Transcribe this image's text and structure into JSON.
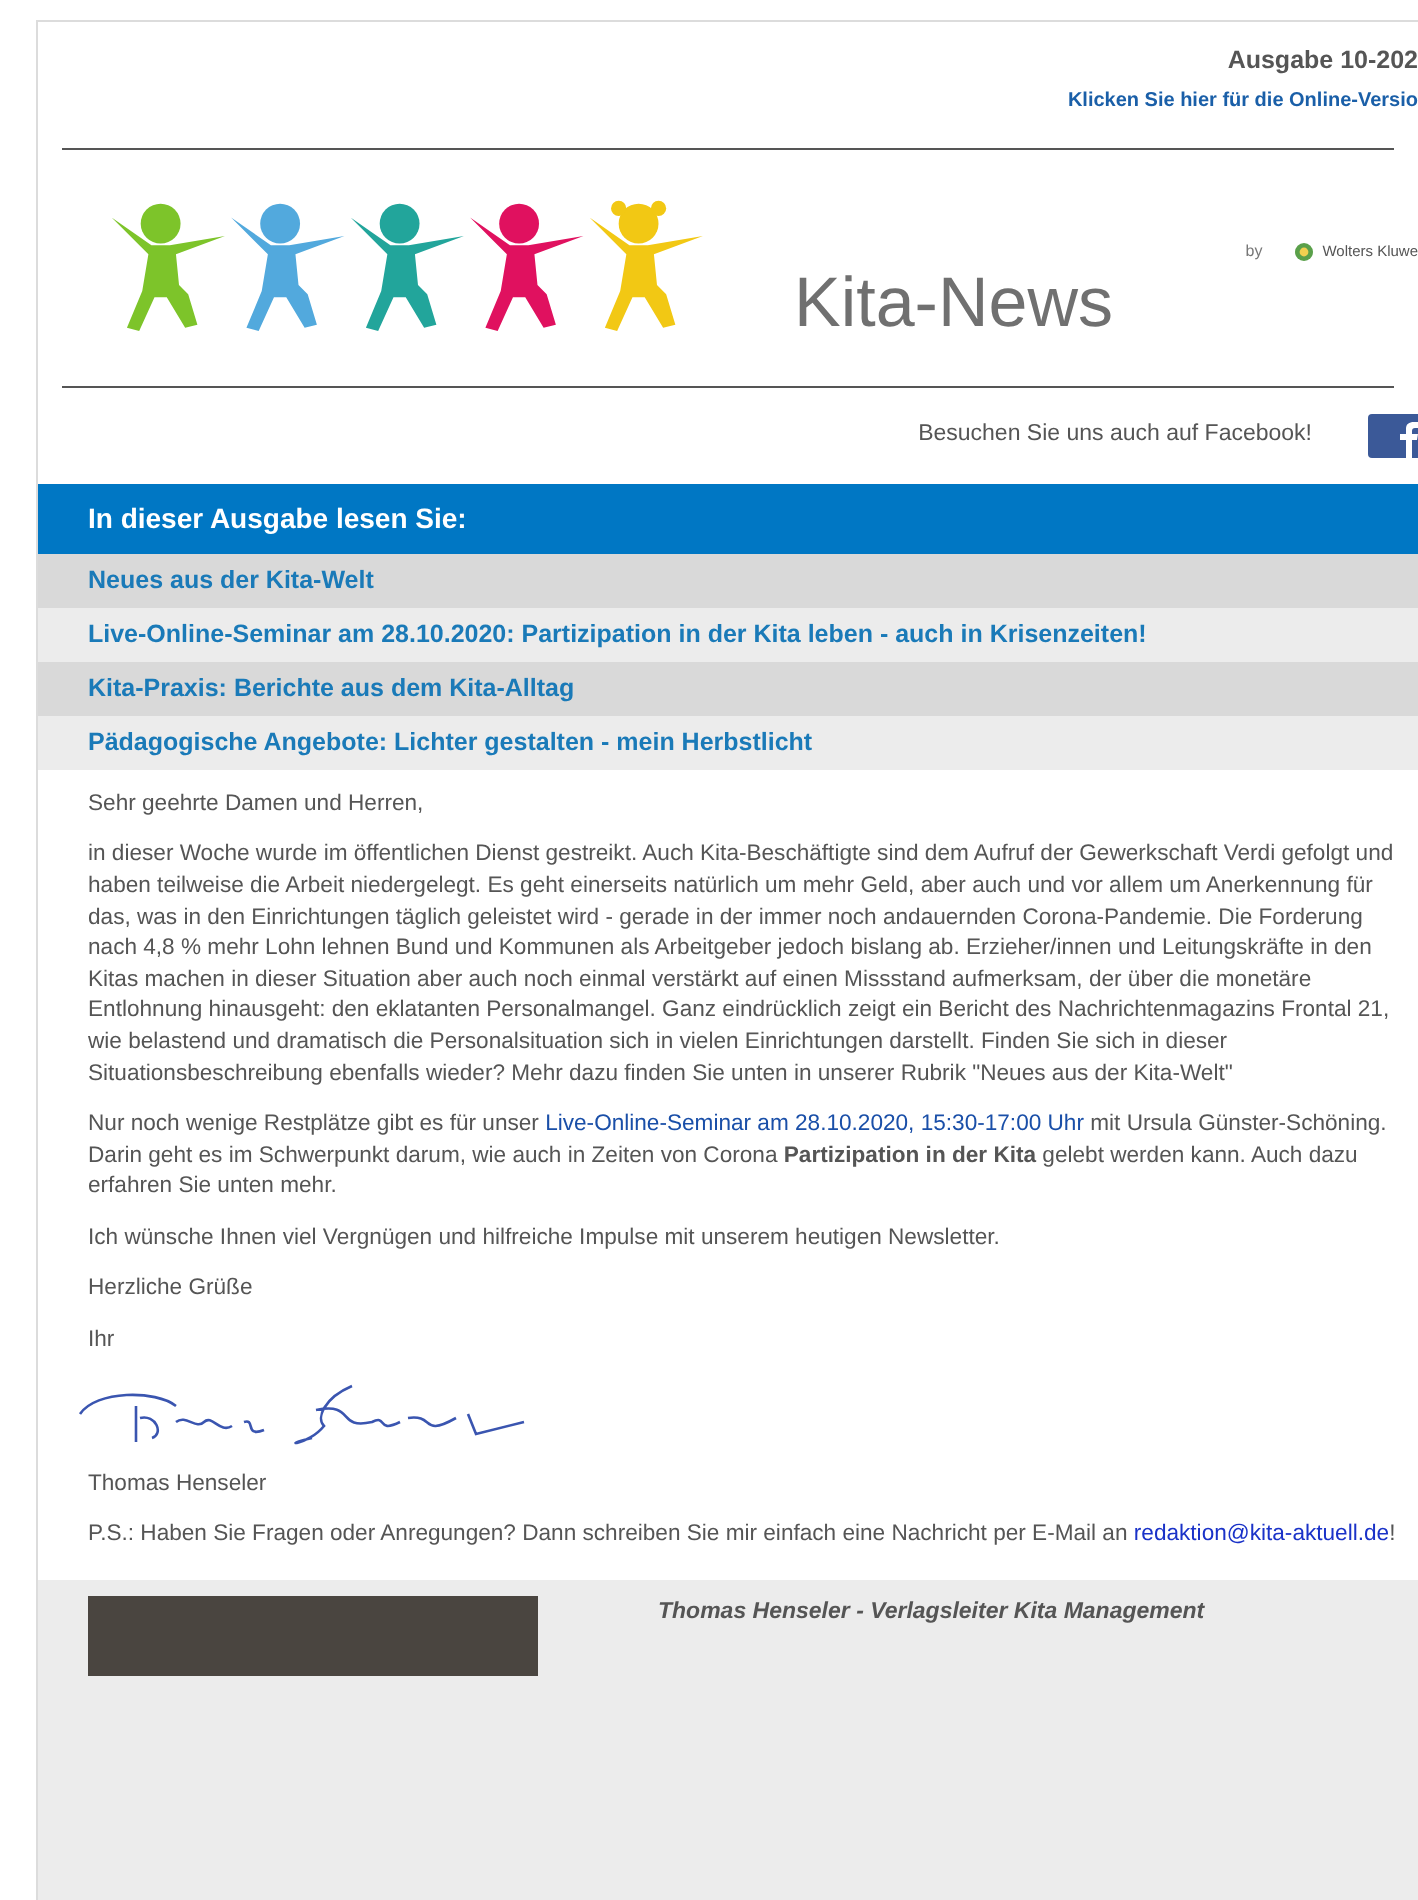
{
  "header": {
    "issue": "Ausgabe 10-202",
    "online_link": "Klicken Sie hier für die Online-Versio"
  },
  "logo": {
    "title": "Kita-News",
    "by": "by",
    "publisher": "Wolters Kluwe"
  },
  "social": {
    "text": "Besuchen Sie uns auch auf Facebook!"
  },
  "toc": {
    "title": "In dieser Ausgabe lesen Sie:",
    "items": [
      {
        "label": "Neues aus der Kita-Welt"
      },
      {
        "label": "Live-Online-Seminar am 28.10.2020: Partizipation in der Kita leben - auch in Krisenzeiten!"
      },
      {
        "label": "Kita-Praxis: Berichte aus dem Kita-Alltag"
      },
      {
        "label": "Pädagogische Angebote: Lichter gestalten - mein Herbstlicht"
      }
    ]
  },
  "letter": {
    "greeting": "Sehr geehrte Damen und Herren,",
    "paragraph_1": "in dieser Woche wurde im öffentlichen Dienst gestreikt. Auch Kita-Beschäftigte sind dem Aufruf der Gewerkschaft Verdi gefolgt und haben teilweise die Arbeit niedergelegt. Es geht einerseits natürlich um mehr Geld, aber auch und vor allem um Anerkennung für das, was in den Einrichtungen täglich geleistet wird - gerade in der immer noch andauernden Corona-Pandemie. Die Forderung nach 4,8 % mehr Lohn lehnen Bund und Kommunen als Arbeitgeber jedoch bislang ab. Erzieher/innen und Leitungskräfte in den Kitas machen in dieser Situation aber auch noch einmal verstärkt auf einen Missstand aufmerksam, der über die monetäre Entlohnung hinausgeht: den eklatanten Personalmangel. Ganz eindrücklich zeigt ein Bericht des Nachrichtenmagazins Frontal 21, wie belastend und dramatisch die Personalsituation sich in vielen Einrichtungen darstellt. Finden Sie sich in dieser Situationsbeschreibung ebenfalls wieder? Mehr dazu finden Sie unten in unserer Rubrik \"Neues aus der Kita-Welt\"",
    "paragraph_2": {
      "before": "Nur noch wenige Restplätze gibt es für unser",
      "link": "Live-Online-Seminar am 28.10.2020, 15:30-17:00 Uhr",
      "after": "mit Ursula Günster-Schöning. Darin geht es im Schwerpunkt darum, wie auch in Zeiten von Corona **Partizipation in der Kita** gelebt werden kann. Auch dazu erfahren Sie unten mehr."
    },
    "paragraph_3": "Ich wünsche Ihnen viel Vergnügen und hilfreiche Impulse mit unserem heutigen Newsletter.",
    "closing": "Herzliche Grüße",
    "closing_2": "Ihr",
    "name": "Thomas Henseler",
    "ps": {
      "before": "P.S.: Haben Sie Fragen oder Anregungen? Dann schreiben Sie mir einfach eine Nachricht per E-Mail an",
      "link": "redaktion@kita-aktuell.de",
      "after": "!"
    }
  },
  "author_box": {
    "caption": "Thomas Henseler - Verlagsleiter Kita Management"
  }
}
